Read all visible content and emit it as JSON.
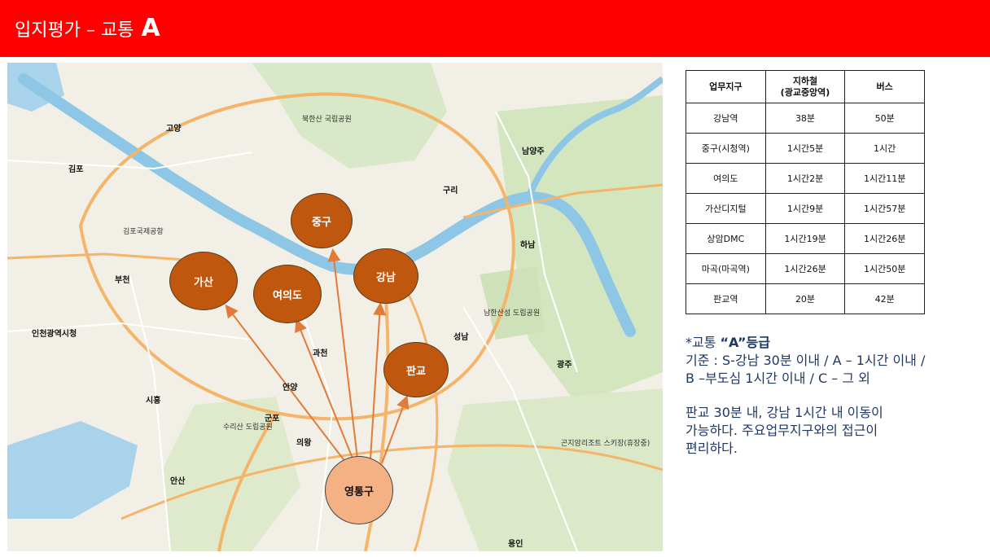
{
  "header": {
    "title": "입지평가 – 교통",
    "grade": "A",
    "background": "#ff0000"
  },
  "map": {
    "nodes": [
      {
        "id": "junggu",
        "label": "중구",
        "color": "#c0570f"
      },
      {
        "id": "gasan",
        "label": "가산",
        "color": "#c0570f"
      },
      {
        "id": "yeouido",
        "label": "여의도",
        "color": "#c0570f"
      },
      {
        "id": "gangnam",
        "label": "강남",
        "color": "#c0570f"
      },
      {
        "id": "pangyo",
        "label": "판교",
        "color": "#c0570f"
      },
      {
        "id": "yeongtong",
        "label": "영통구",
        "color": "#f4b183"
      }
    ],
    "arrow_color": "#e07b39",
    "place_labels": {
      "goyang": "고양",
      "gimpo": "김포",
      "bucheon": "부천",
      "incheon": "인천광역시청",
      "guri": "구리",
      "namyangju": "남양주",
      "hanam": "하남",
      "seongnam": "성남",
      "gwacheon": "과천",
      "anyang": "안양",
      "gunpo": "군포",
      "siheung": "시흥",
      "uiwang": "의왕",
      "ansan": "안산",
      "gwangju": "광주",
      "yongin": "용인",
      "gimpo_airport": "김포국제공항",
      "bukhansan": "북한산 국립공원",
      "namhansanseong": "남한산성 도립공원",
      "surisan": "수리산 도립공원",
      "konjiam": "곤지암리조트 스키장(휴장중)"
    }
  },
  "table": {
    "headers": [
      "업무지구",
      "지하철\n(광교중앙역)",
      "버스"
    ],
    "rows": [
      [
        "강남역",
        "38분",
        "50분"
      ],
      [
        "중구(시청역)",
        "1시간5분",
        "1시간"
      ],
      [
        "여의도",
        "1시간2분",
        "1시간11분"
      ],
      [
        "가산디지털",
        "1시간9분",
        "1시간57분"
      ],
      [
        "상암DMC",
        "1시간19분",
        "1시간26분"
      ],
      [
        "마곡(마곡역)",
        "1시간26분",
        "1시간50분"
      ],
      [
        "판교역",
        "20분",
        "42분"
      ]
    ]
  },
  "notes": {
    "title_prefix": "*교통 ",
    "title_bold": "“A”등급",
    "criteria_line1": "기준 : S-강남 30분 이내 / A – 1시간 이내 /",
    "criteria_line2": "B –부도심 1시간 이내 / C – 그 외",
    "summary_line1": "판교 30분 내, 강남 1시간 내 이동이",
    "summary_line2": "가능하다. 주요업무지구와의 접근이",
    "summary_line3": "편리하다.",
    "text_color": "#1f3864"
  }
}
